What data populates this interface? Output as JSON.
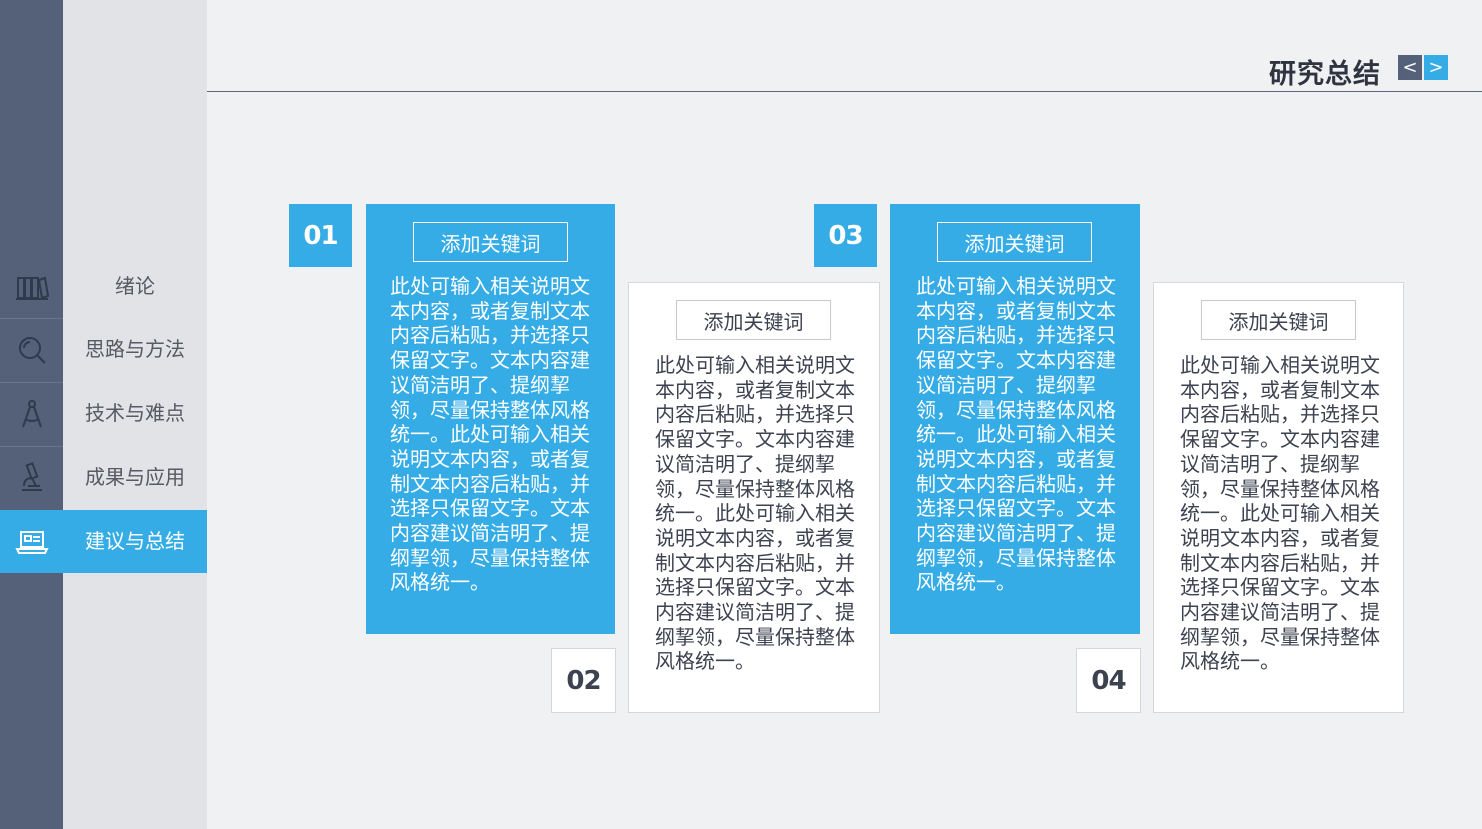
{
  "title": "研究总结",
  "nav": {
    "prev_symbol": "<",
    "next_symbol": ">"
  },
  "sidebar": {
    "items": [
      {
        "label": "绪论",
        "icon": "books-icon"
      },
      {
        "label": "思路与方法",
        "icon": "magnifier-icon"
      },
      {
        "label": "技术与难点",
        "icon": "compass-icon"
      },
      {
        "label": "成果与应用",
        "icon": "microscope-icon"
      },
      {
        "label": "建议与总结",
        "icon": "laptop-icon",
        "active": true
      }
    ]
  },
  "cards": [
    {
      "number": "01",
      "keyword": "添加关键词",
      "text": "此处可输入相关说明文本内容，或者复制文本内容后粘贴，并选择只保留文字。文本内容建议简洁明了、提纲挈领，尽量保持整体风格统一。此处可输入相关说明文本内容，或者复制文本内容后粘贴，并选择只保留文字。文本内容建议简洁明了、提纲挈领，尽量保持整体风格统一。"
    },
    {
      "number": "02",
      "keyword": "添加关键词",
      "text": "此处可输入相关说明文本内容，或者复制文本内容后粘贴，并选择只保留文字。文本内容建议简洁明了、提纲挈领，尽量保持整体风格统一。此处可输入相关说明文本内容，或者复制文本内容后粘贴，并选择只保留文字。文本内容建议简洁明了、提纲挈领，尽量保持整体风格统一。"
    },
    {
      "number": "03",
      "keyword": "添加关键词",
      "text": "此处可输入相关说明文本内容，或者复制文本内容后粘贴，并选择只保留文字。文本内容建议简洁明了、提纲挈领，尽量保持整体风格统一。此处可输入相关说明文本内容，或者复制文本内容后粘贴，并选择只保留文字。文本内容建议简洁明了、提纲挈领，尽量保持整体风格统一。"
    },
    {
      "number": "04",
      "keyword": "添加关键词",
      "text": "此处可输入相关说明文本内容，或者复制文本内容后粘贴，并选择只保留文字。文本内容建议简洁明了、提纲挈领，尽量保持整体风格统一。此处可输入相关说明文本内容，或者复制文本内容后粘贴，并选择只保留文字。文本内容建议简洁明了、提纲挈领，尽量保持整体风格统一。"
    }
  ],
  "colors": {
    "accent": "#35ace6",
    "sidebar_dark": "#546178",
    "sidebar_light": "#e2e3e6",
    "background": "#f0f1f3"
  }
}
